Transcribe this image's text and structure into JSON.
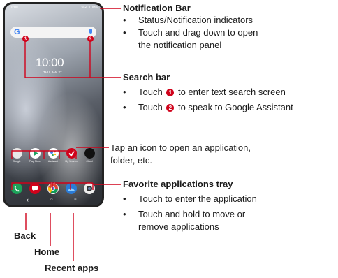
{
  "phone": {
    "status_time": "10:00",
    "status_indicators": "5GL 100%",
    "clock": "10:00",
    "date": "THU, JAN 27",
    "search_badge_1": "1",
    "search_badge_2": "2",
    "apps": [
      {
        "label": "Google",
        "color": "#e8e8e8"
      },
      {
        "label": "Play Store",
        "color": "#ffffff"
      },
      {
        "label": "Assistant",
        "color": "#ffffff"
      },
      {
        "label": "My Verizon",
        "color": "#d0021b"
      },
      {
        "label": "Cloud",
        "color": "#111111"
      }
    ],
    "tray_icons": [
      {
        "icon": "phone-icon",
        "color": "#1ca35a"
      },
      {
        "icon": "messages-icon",
        "color": "#d0021b"
      },
      {
        "icon": "chrome-icon",
        "color": "#ffffff"
      },
      {
        "icon": "photos-icon",
        "color": "#2a7bd8"
      },
      {
        "icon": "camera-icon",
        "color": "#eeeeee"
      }
    ],
    "nav": {
      "back": "‹",
      "home": "○",
      "recent": "≡"
    }
  },
  "callouts": {
    "notification": {
      "heading": "Notification Bar",
      "bullets": [
        "Status/Notification indicators",
        "Touch and drag down to open",
        "the notification panel"
      ]
    },
    "search": {
      "heading": "Search bar",
      "bullet1_prefix": "Touch",
      "bullet1_badge": "1",
      "bullet1_suffix": "to enter text search screen",
      "bullet2_prefix": "Touch",
      "bullet2_badge": "2",
      "bullet2_suffix": "to speak to Google Assistant"
    },
    "apps": {
      "line1": "Tap an icon to open an application,",
      "line2": "folder, etc."
    },
    "favorites": {
      "heading": "Favorite applications tray",
      "bullets": [
        "Touch to enter the application",
        "Touch and hold to move or",
        "remove applications"
      ]
    },
    "back": "Back",
    "home": "Home",
    "recent": "Recent apps"
  },
  "colors": {
    "accent_red": "#d0021b",
    "text": "#1a1a1a"
  }
}
